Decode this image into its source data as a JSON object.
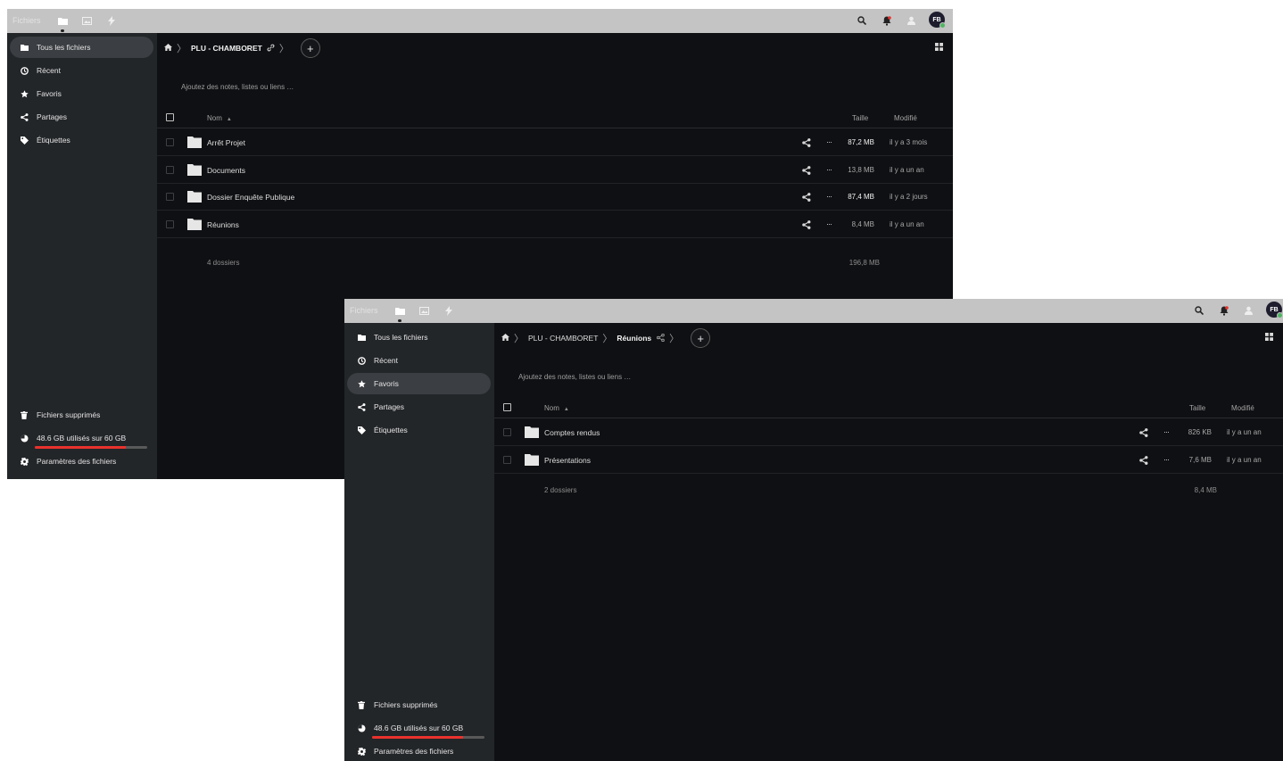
{
  "app": {
    "brand": "Fichiers",
    "avatar_initials": "FB",
    "status_color": "#4eb562",
    "quota_color": "#e9322d",
    "quota_fraction": 0.81
  },
  "window1": {
    "nav": [
      {
        "label": "Tous les fichiers",
        "icon": "folder-icon",
        "active": true
      },
      {
        "label": "Récent",
        "icon": "clock-icon",
        "active": false
      },
      {
        "label": "Favoris",
        "icon": "star-icon",
        "active": false
      },
      {
        "label": "Partages",
        "icon": "share-icon",
        "active": false
      },
      {
        "label": "Étiquettes",
        "icon": "tag-icon",
        "active": false
      }
    ],
    "bottom_nav": {
      "deleted": "Fichiers supprimés",
      "quota": "48.6 GB utilisés sur 60 GB",
      "settings": "Paramètres des fichiers"
    },
    "breadcrumb": {
      "folder": "PLU - CHAMBORET"
    },
    "notes_placeholder": "Ajoutez des notes, listes ou liens …",
    "columns": {
      "name": "Nom",
      "size": "Taille",
      "modified": "Modifié"
    },
    "rows": [
      {
        "name": "Arrêt Projet",
        "size": "87,2 MB",
        "modified": "il y a 3 mois",
        "big": true
      },
      {
        "name": "Documents",
        "size": "13,8 MB",
        "modified": "il y a un an",
        "big": false
      },
      {
        "name": "Dossier Enquête Publique",
        "size": "87,4 MB",
        "modified": "il y a 2 jours",
        "big": true
      },
      {
        "name": "Réunions",
        "size": "8,4 MB",
        "modified": "il y a un an",
        "big": false
      }
    ],
    "summary": {
      "count": "4 dossiers",
      "total": "196,8 MB"
    }
  },
  "window2": {
    "nav": [
      {
        "label": "Tous les fichiers",
        "icon": "folder-icon",
        "active": false
      },
      {
        "label": "Récent",
        "icon": "clock-icon",
        "active": false
      },
      {
        "label": "Favoris",
        "icon": "star-icon",
        "active": true
      },
      {
        "label": "Partages",
        "icon": "share-icon",
        "active": false
      },
      {
        "label": "Étiquettes",
        "icon": "tag-icon",
        "active": false
      }
    ],
    "bottom_nav": {
      "deleted": "Fichiers supprimés",
      "quota": "48.6 GB utilisés sur 60 GB",
      "settings": "Paramètres des fichiers"
    },
    "breadcrumb": {
      "parent": "PLU - CHAMBORET",
      "current": "Réunions"
    },
    "notes_placeholder": "Ajoutez des notes, listes ou liens …",
    "columns": {
      "name": "Nom",
      "size": "Taille",
      "modified": "Modifié"
    },
    "rows": [
      {
        "name": "Comptes rendus",
        "size": "826 KB",
        "modified": "il y a un an",
        "big": false
      },
      {
        "name": "Présentations",
        "size": "7,6 MB",
        "modified": "il y a un an",
        "big": false
      }
    ],
    "summary": {
      "count": "2 dossiers",
      "total": "8,4 MB"
    }
  }
}
